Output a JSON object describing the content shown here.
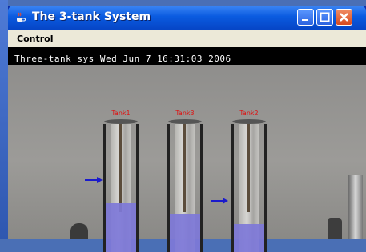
{
  "window": {
    "title": "The 3-tank System"
  },
  "menu": {
    "items": [
      "Control"
    ]
  },
  "video": {
    "timestamp": "Three-tank sys Wed Jun  7 16:31:03 2006",
    "tanks": [
      {
        "label": "Tank1",
        "water_level": 0.38
      },
      {
        "label": "Tank3",
        "water_level": 0.3
      },
      {
        "label": "Tank2",
        "water_level": 0.22
      }
    ]
  },
  "colors": {
    "title_bar": "#0a5be0",
    "water": "#7e78d8",
    "tank_label": "#e01010",
    "arrow": "#1a1acc"
  }
}
